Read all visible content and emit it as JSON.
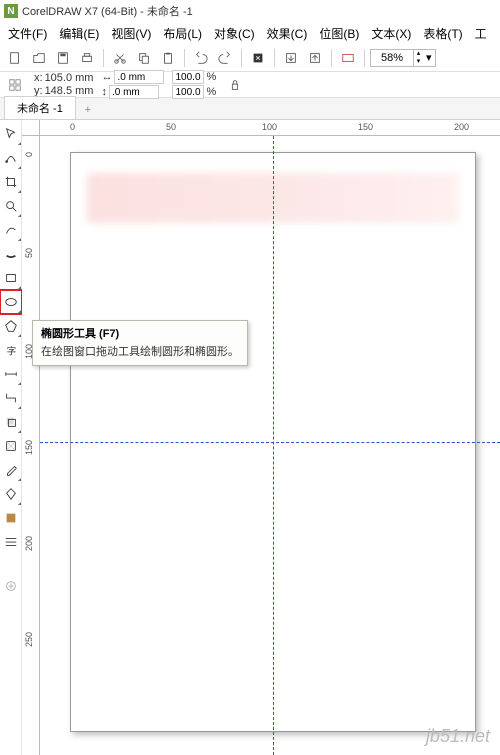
{
  "title": "CorelDRAW X7 (64-Bit) - 未命名 -1",
  "menus": [
    "文件(F)",
    "编辑(E)",
    "视图(V)",
    "布局(L)",
    "对象(C)",
    "效果(C)",
    "位图(B)",
    "文本(X)",
    "表格(T)",
    "工"
  ],
  "zoom": "58%",
  "coords": {
    "x": "105.0 mm",
    "y": "148.5 mm"
  },
  "dims": {
    "w": ".0 mm",
    "h": ".0 mm"
  },
  "pct": {
    "w": "100.0",
    "h": "100.0"
  },
  "tab": "未命名 -1",
  "ruler_h": [
    "0",
    "50",
    "100",
    "150",
    "200"
  ],
  "ruler_v": [
    "0",
    "50",
    "100",
    "150",
    "200",
    "250"
  ],
  "tooltip": {
    "title": "椭圆形工具 (F7)",
    "desc": "在绘图窗口拖动工具绘制圆形和椭圆形。"
  },
  "watermark": "jb51.net"
}
